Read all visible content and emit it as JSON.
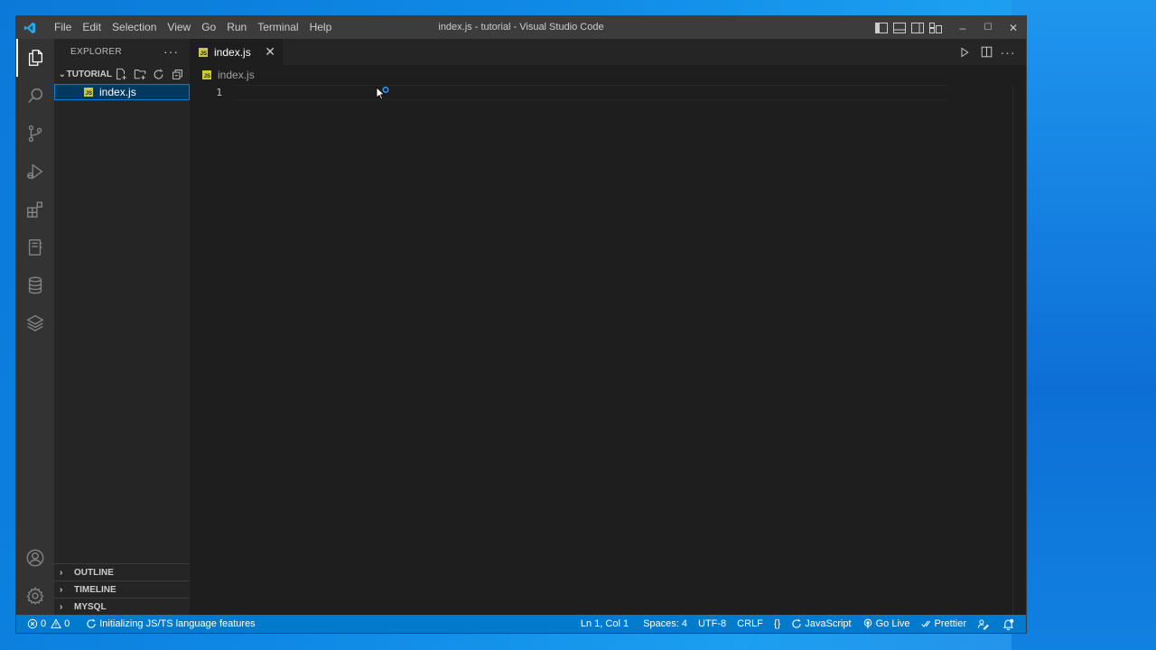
{
  "window": {
    "title": "index.js - tutorial - Visual Studio Code"
  },
  "menu": [
    "File",
    "Edit",
    "Selection",
    "View",
    "Go",
    "Run",
    "Terminal",
    "Help"
  ],
  "window_controls": {
    "minimize": "–",
    "maximize": "☐",
    "close": "✕"
  },
  "activity_bar": {
    "items": [
      "explorer-icon",
      "search-icon",
      "source-control-icon",
      "run-debug-icon",
      "extensions-icon",
      "notebook-icon",
      "database-icon",
      "layers-icon"
    ],
    "bottom": [
      "account-icon",
      "settings-gear-icon"
    ]
  },
  "sidebar": {
    "header": "EXPLORER",
    "more": "···",
    "folder": {
      "chevron": "⌄",
      "name": "TUTORIAL",
      "files": [
        {
          "badge": "JS",
          "name": "index.js"
        }
      ]
    },
    "panels": [
      {
        "chevron": "›",
        "label": "OUTLINE"
      },
      {
        "chevron": "›",
        "label": "TIMELINE"
      },
      {
        "chevron": "›",
        "label": "MYSQL"
      }
    ]
  },
  "editor": {
    "tab": {
      "badge": "JS",
      "label": "index.js",
      "close": "✕"
    },
    "breadcrumb": {
      "badge": "JS",
      "label": "index.js"
    },
    "lines": [
      {
        "num": "1",
        "text": ""
      }
    ]
  },
  "statusbar": {
    "errors": "0",
    "warnings": "0",
    "progress": "Initializing JS/TS language features",
    "position": "Ln 1, Col 1",
    "spaces": "Spaces: 4",
    "encoding": "UTF-8",
    "eol": "CRLF",
    "braces": "{}",
    "language": "JavaScript",
    "go_live": "Go Live",
    "prettier": "Prettier"
  },
  "colors": {
    "accent": "#007acc",
    "activity_bar": "#333333",
    "sidebar": "#252526",
    "editor": "#1e1e1e",
    "titlebar": "#3c3c3c",
    "js_badge": "#cbcb41"
  }
}
